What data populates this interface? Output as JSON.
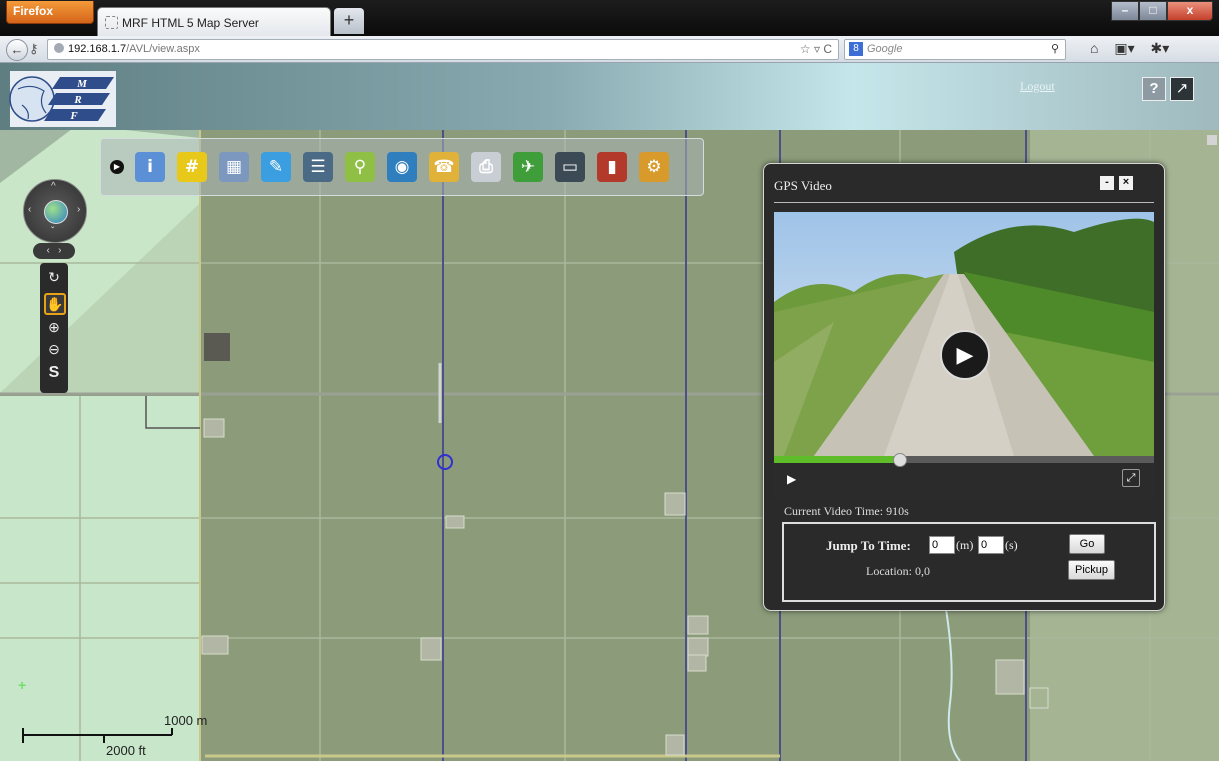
{
  "browser": {
    "app_button": "Firefox",
    "tab_title": "MRF HTML 5 Map Server",
    "url_host": "192.168.1.7",
    "url_path": "/AVL/view.aspx",
    "search_engine": "Google",
    "search_placeholder": "Google"
  },
  "header": {
    "logout_label": "Logout",
    "help_label": "?"
  },
  "toolbar": {
    "tools": [
      "info-icon",
      "measure-grid-icon",
      "table-icon",
      "edit-icon",
      "layers-list-icon",
      "search-icon",
      "zoom-to-icon",
      "contacts-icon",
      "print-icon",
      "gps-satellite-icon",
      "device-icon",
      "book-icon",
      "user-tools-icon"
    ]
  },
  "map": {
    "scale_metric": "1000 m",
    "scale_imperial": "2000 ft"
  },
  "gps_video": {
    "title": "GPS Video",
    "minimize_label": "-",
    "close_label": "×",
    "progress_fraction": 0.33,
    "current_time_text": "Current Video Time: 910s",
    "jump_label": "Jump To Time:",
    "minutes_value": "0",
    "minutes_unit": "(m)",
    "seconds_value": "0",
    "seconds_unit": "(s)",
    "go_label": "Go",
    "location_text": "Location: 0,0",
    "pickup_label": "Pickup"
  },
  "colors": {
    "accent_green": "#5fbd2a",
    "marker_blue": "#2e2fd6",
    "firefox_orange": "#e57a26"
  }
}
